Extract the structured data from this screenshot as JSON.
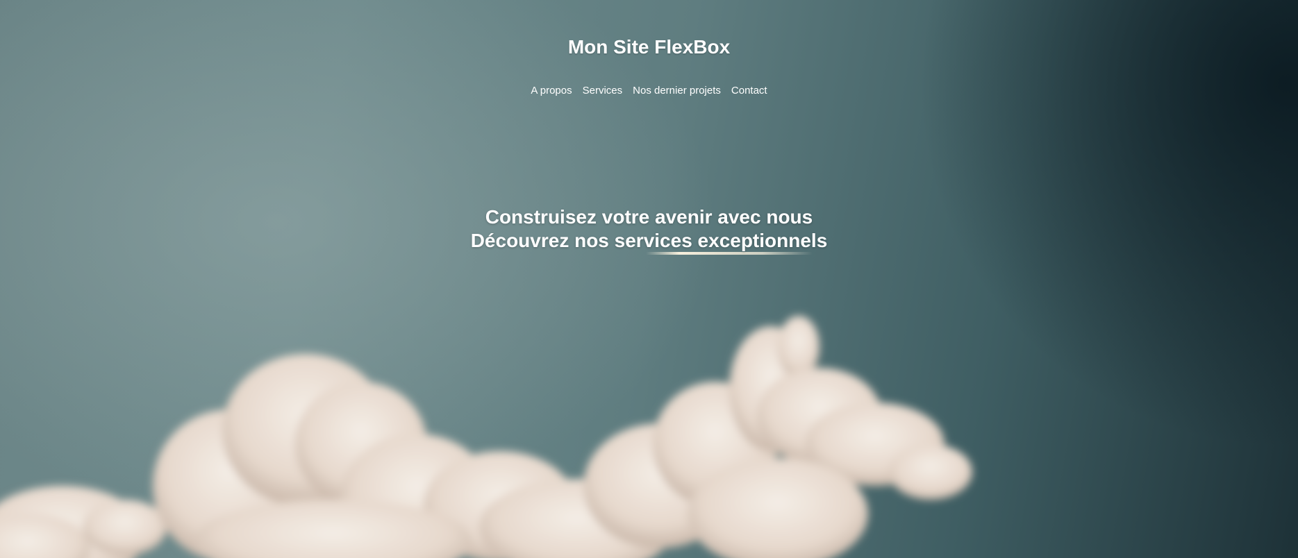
{
  "header": {
    "site_title": "Mon Site FlexBox"
  },
  "nav": {
    "items": [
      {
        "label": "A propos"
      },
      {
        "label": "Services"
      },
      {
        "label": "Nos dernier projets"
      },
      {
        "label": "Contact"
      }
    ]
  },
  "hero": {
    "line1": "Construisez votre avenir avec nous",
    "line2": "Découvrez nos services exceptionnels"
  },
  "colors": {
    "text": "#ffffff",
    "sky": "#6a8486",
    "sky_dark": "#1d3137",
    "cloud": "#efe6de"
  }
}
